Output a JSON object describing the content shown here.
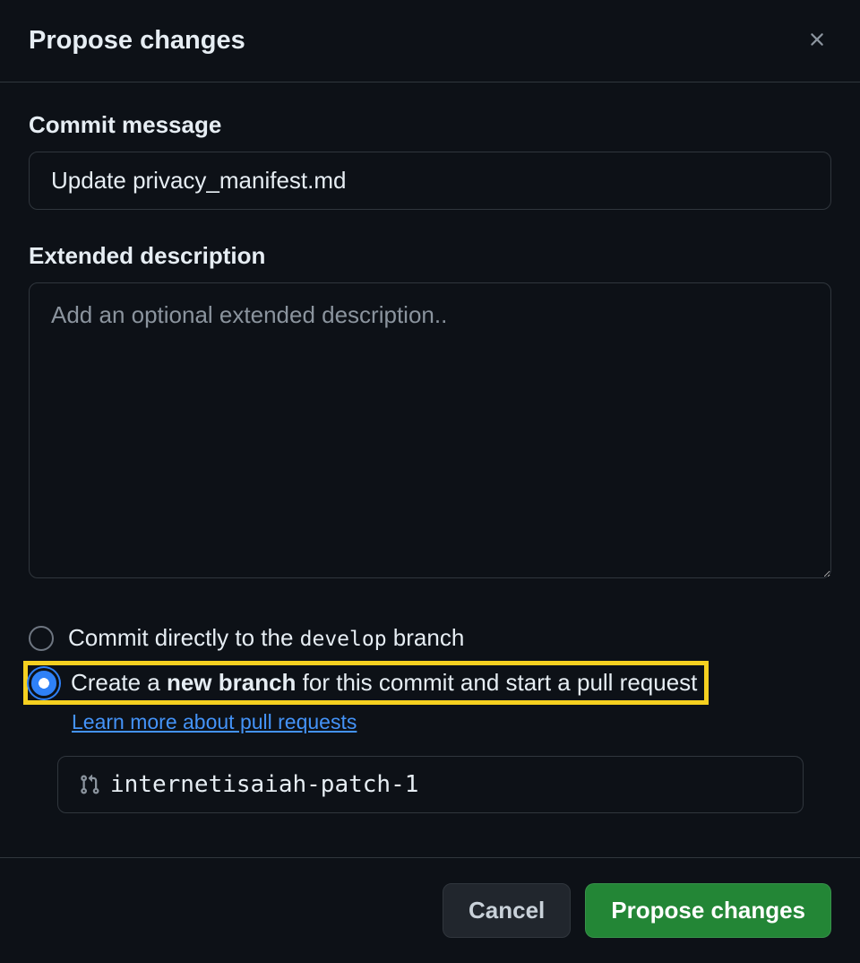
{
  "header": {
    "title": "Propose changes"
  },
  "commit": {
    "label": "Commit message",
    "value": "Update privacy_manifest.md"
  },
  "description": {
    "label": "Extended description",
    "placeholder": "Add an optional extended description.."
  },
  "radios": {
    "direct": {
      "prefix": "Commit directly to the ",
      "branch": "develop",
      "suffix": " branch"
    },
    "newbranch": {
      "prefix": "Create a ",
      "bold": "new branch",
      "suffix": " for this commit and start a pull request"
    }
  },
  "learn_more": "Learn more about pull requests",
  "branch_input": {
    "value": "internetisaiah-patch-1"
  },
  "footer": {
    "cancel": "Cancel",
    "submit": "Propose changes"
  }
}
